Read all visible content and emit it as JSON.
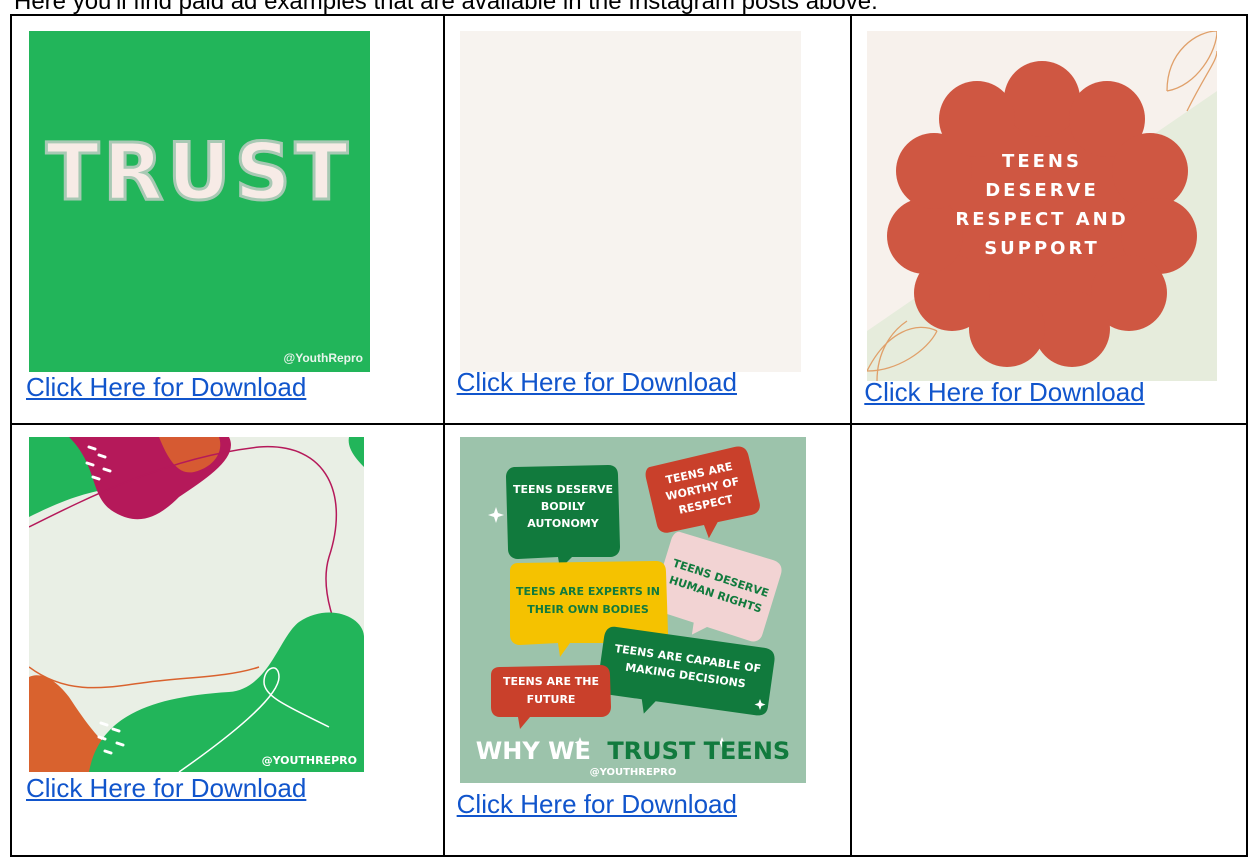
{
  "document": {
    "intro_text": "Here you'll find paid ad examples that are available in the Instagram posts above:"
  },
  "cells": [
    {
      "image": {
        "title": "TRUST",
        "watermark": "@YouthRepro",
        "colors": {
          "background": "#22b55a",
          "letters": "#f7ebe6"
        }
      },
      "link_label": "Click Here for Download"
    },
    {
      "image": {
        "colors": {
          "background": "#f7f3ef"
        }
      },
      "link_label": "Click Here for Download"
    },
    {
      "image": {
        "lines": [
          "TEENS",
          "DESERVE",
          "RESPECT AND",
          "SUPPORT"
        ],
        "colors": {
          "background": "#f7f1ec",
          "accent": "#e6ecdc",
          "flower": "#cf5742",
          "text": "#ffffff"
        }
      },
      "link_label": "Click Here for Download"
    },
    {
      "image": {
        "watermark": "@YOUTHREPRO",
        "colors": {
          "background": "#e9efe5",
          "green": "#22b55a",
          "magenta": "#b5195a",
          "orange": "#d9622e"
        }
      },
      "link_label": "Click Here for Download"
    },
    {
      "image": {
        "bubbles": [
          {
            "lines": [
              "TEENS DESERVE",
              "BODILY",
              "AUTONOMY"
            ]
          },
          {
            "lines": [
              "TEENS ARE",
              "WORTHY OF",
              "RESPECT"
            ]
          },
          {
            "lines": [
              "TEENS DESERVE",
              "HUMAN RIGHTS"
            ]
          },
          {
            "lines": [
              "TEENS ARE EXPERTS IN",
              "THEIR OWN BODIES"
            ]
          },
          {
            "lines": [
              "TEENS ARE CAPABLE OF",
              "MAKING DECISIONS"
            ]
          },
          {
            "lines": [
              "TEENS ARE THE",
              "FUTURE"
            ]
          }
        ],
        "headline_part1": "WHY WE",
        "headline_part2": "TRUST TEENS",
        "watermark": "@YOUTHREPRO",
        "colors": {
          "background": "#9cc3ab",
          "dark_green": "#117a3d",
          "red": "#c9402b",
          "pink": "#f2d3d3",
          "yellow": "#f5c200"
        }
      },
      "link_label": "Click Here for Download"
    }
  ]
}
